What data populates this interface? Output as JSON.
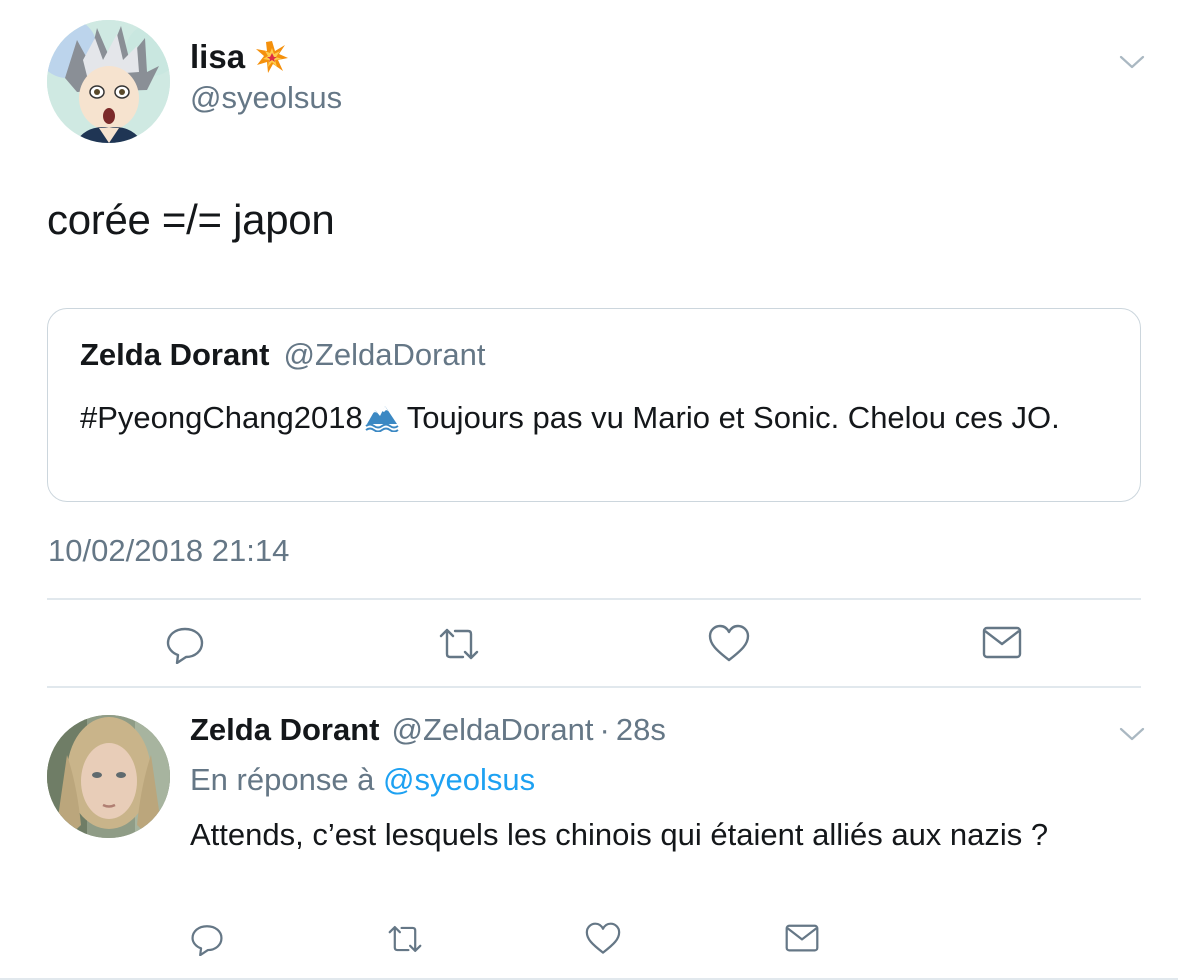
{
  "main_tweet": {
    "name": "lisa",
    "name_emoji_icon": "collision-icon",
    "handle": "@syeolsus",
    "text": "corée =/= japon",
    "timestamp": "10/02/2018 21:14",
    "quoted_tweet": {
      "name": "Zelda Dorant",
      "handle": "@ZeldaDorant",
      "text_before_emoji": "#PyeongChang2018",
      "emoji_icon": "snow-mountain-water-icon",
      "text_after_emoji": "Toujours pas vu Mario et Sonic. Chelou ces JO."
    },
    "actions": [
      "reply-icon",
      "retweet-icon",
      "like-icon",
      "message-icon"
    ]
  },
  "reply_tweet": {
    "name": "Zelda Dorant",
    "handle": "@ZeldaDorant",
    "dot": "·",
    "time": "28s",
    "reply_prefix": "En réponse à",
    "reply_to": "@syeolsus",
    "text": "Attends, c’est lesquels les chinois qui étaient alliés aux nazis ?",
    "actions": [
      "reply-icon",
      "retweet-icon",
      "like-icon",
      "message-icon"
    ]
  },
  "colors": {
    "text": "#14171a",
    "secondary": "#657786",
    "link": "#1da1f2",
    "border": "#ccd6dd",
    "divider": "#e1e8ed"
  }
}
